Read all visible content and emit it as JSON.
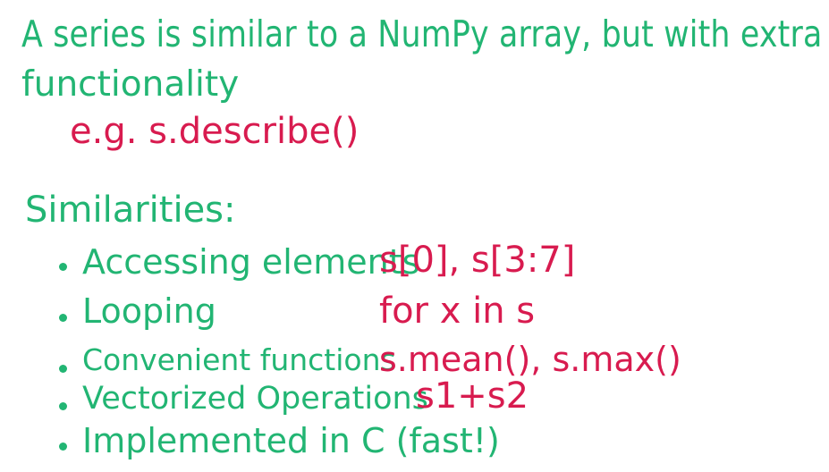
{
  "slide": {
    "intro_line1": "A series is similar to a NumPy array, but with extra",
    "intro_line2": "functionality",
    "example": "e.g.  s.describe()",
    "similarities_title": "Similarities:",
    "items": [
      {
        "label": "Accessing elements",
        "code": "s[0], s[3:7]"
      },
      {
        "label": "Looping",
        "code": "for x in s"
      },
      {
        "label": "Convenient functions",
        "code": "s.mean(), s.max()"
      },
      {
        "label": "Vectorized Operations",
        "code": "s1+s2"
      },
      {
        "label": "Implemented in C (fast!)",
        "code": ""
      }
    ]
  },
  "colors": {
    "text_green": "#22b573",
    "text_red": "#d81b4f",
    "background": "#ffffff"
  }
}
